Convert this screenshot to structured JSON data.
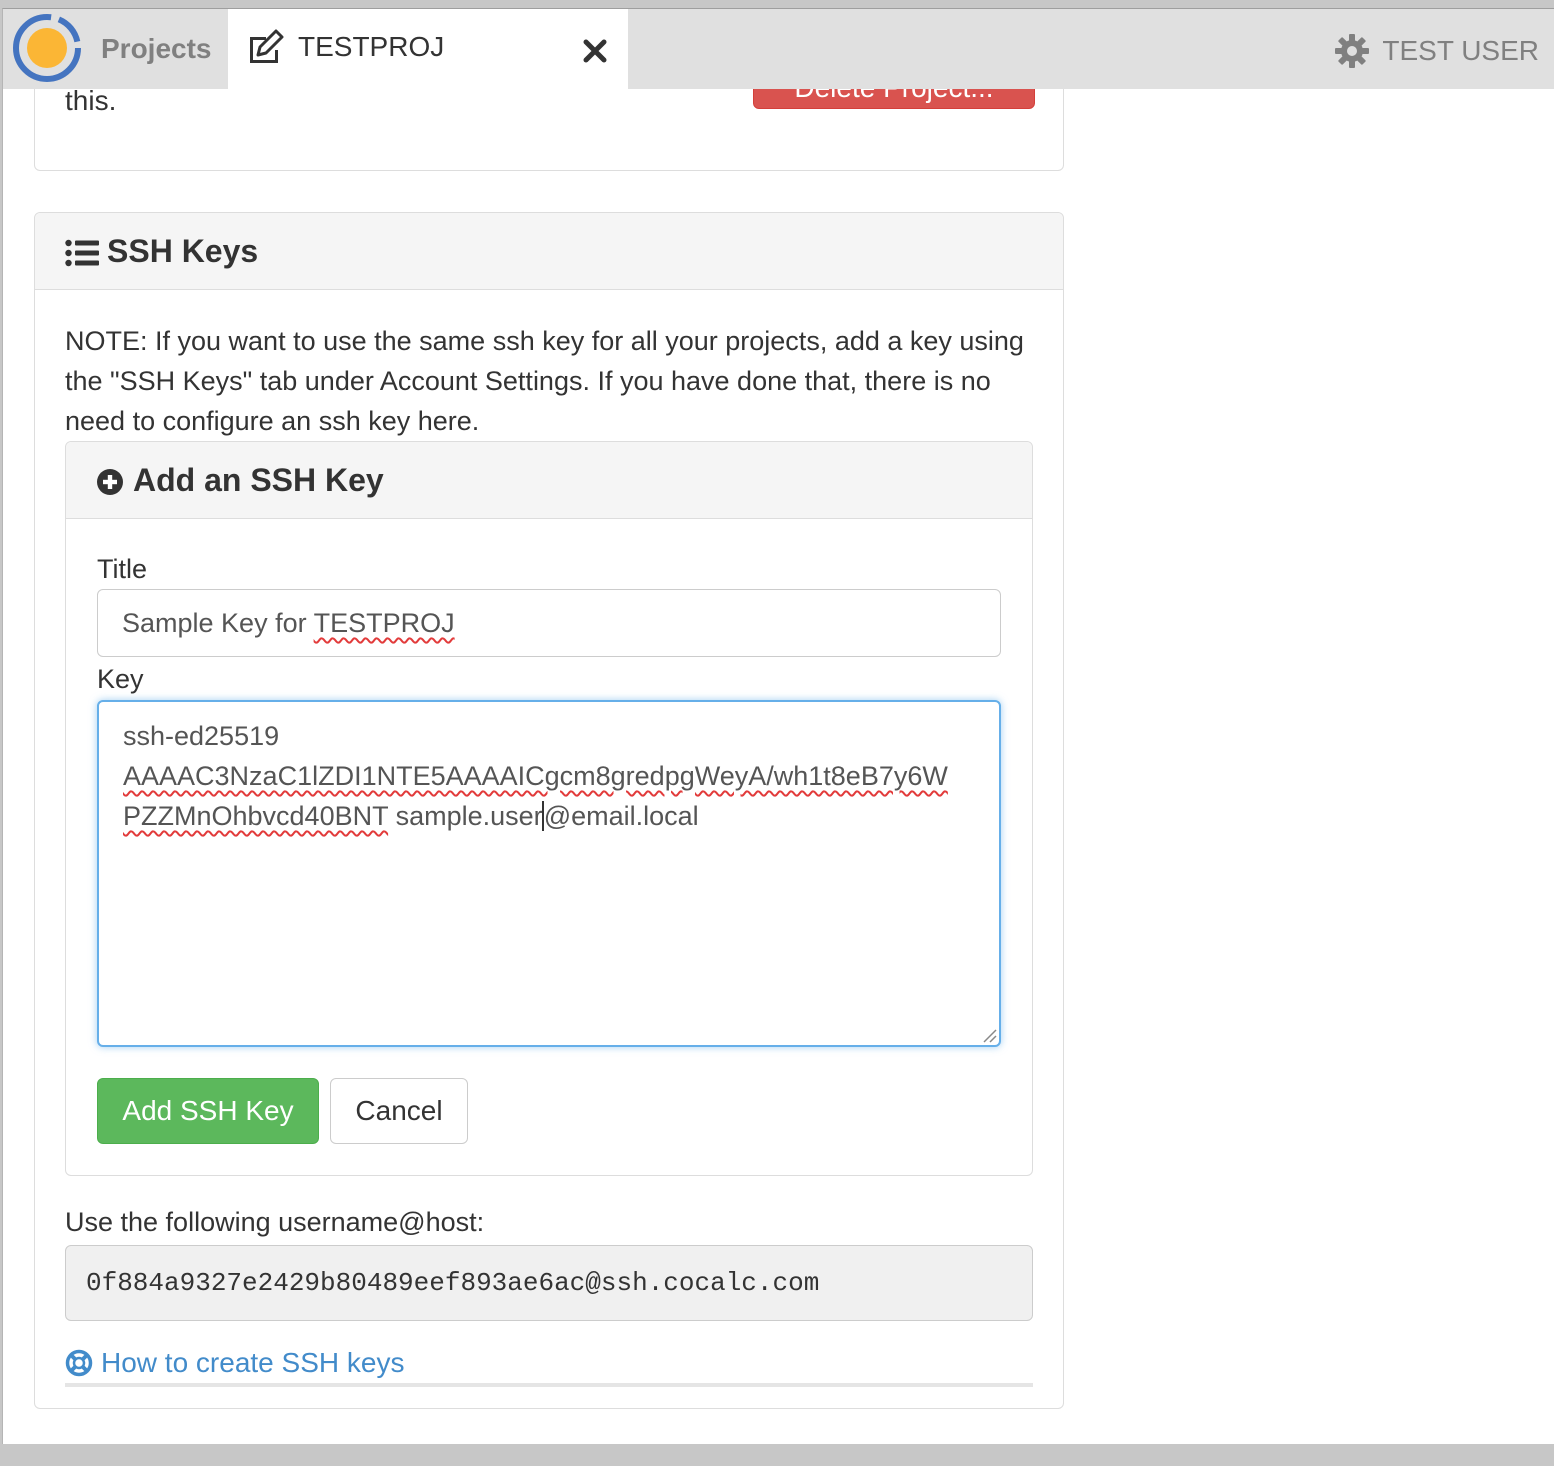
{
  "nav": {
    "projects_label": "Projects",
    "project_tab_label": "TESTPROJ",
    "account_label": "TEST USER",
    "icons": {
      "logo": "cocalc-logo-icon",
      "edit": "edit-icon",
      "close": "close-icon",
      "settings": "gear-icon"
    }
  },
  "delete_panel": {
    "text": "this.",
    "delete_button_label": "Delete Project...",
    "button_color": "#d9534f"
  },
  "ssh_panel": {
    "title": "SSH Keys",
    "note": "NOTE: If you want to use the same ssh key for all your projects, add a key using the \"SSH Keys\" tab under Account Settings. If you have done that, there is no need to configure an ssh key here.",
    "add_panel": {
      "title": "Add an SSH Key",
      "title_label": "Title",
      "title_value": "Sample Key for TESTPROJ",
      "key_label": "Key",
      "key_value_lines": [
        "ssh-ed25519",
        "AAAAC3NzaC1lZDI1NTE5AAAAICgcm8gredpgWeyA/wh1t8eB7y6W",
        "PZZMnOhbvcd40BNT sample.user@email.local"
      ],
      "add_button_label": "Add SSH Key",
      "cancel_button_label": "Cancel",
      "add_button_color": "#5cb85c"
    },
    "host_label": "Use the following username@host:",
    "host_value": "0f884a9327e2429b80489eef893ae6ac@ssh.cocalc.com",
    "help_link": "How to create SSH keys",
    "link_color": "#428bca"
  }
}
